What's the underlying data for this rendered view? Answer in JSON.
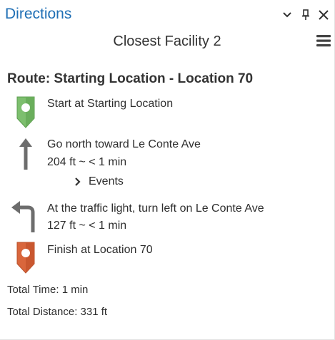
{
  "pane": {
    "title": "Directions",
    "icons": [
      "chevron-down-icon",
      "pin-icon",
      "close-icon"
    ]
  },
  "header": {
    "layer_name": "Closest Facility 2",
    "menu_icon": "hamburger-menu-icon"
  },
  "route": {
    "title": "Route: Starting Location - Location 70",
    "steps": [
      {
        "icon": "start-marker-icon",
        "text": "Start at Starting Location",
        "detail": ""
      },
      {
        "icon": "arrow-up-icon",
        "text": "Go north toward Le Conte Ave",
        "detail": "204 ft ~ < 1 min",
        "events_label": "Events"
      },
      {
        "icon": "turn-left-arrow-icon",
        "text": "At the traffic light, turn left on Le Conte Ave",
        "detail": "127 ft ~ < 1 min"
      },
      {
        "icon": "finish-marker-icon",
        "text": "Finish at Location 70",
        "detail": ""
      }
    ]
  },
  "summary": {
    "total_time": "Total Time: 1 min",
    "total_distance": "Total Distance: 331 ft"
  },
  "colors": {
    "title_blue": "#1f6fb5",
    "start_green": "#7dbf6e",
    "finish_orange": "#d9663c",
    "arrow_gray": "#6d6d6d"
  }
}
